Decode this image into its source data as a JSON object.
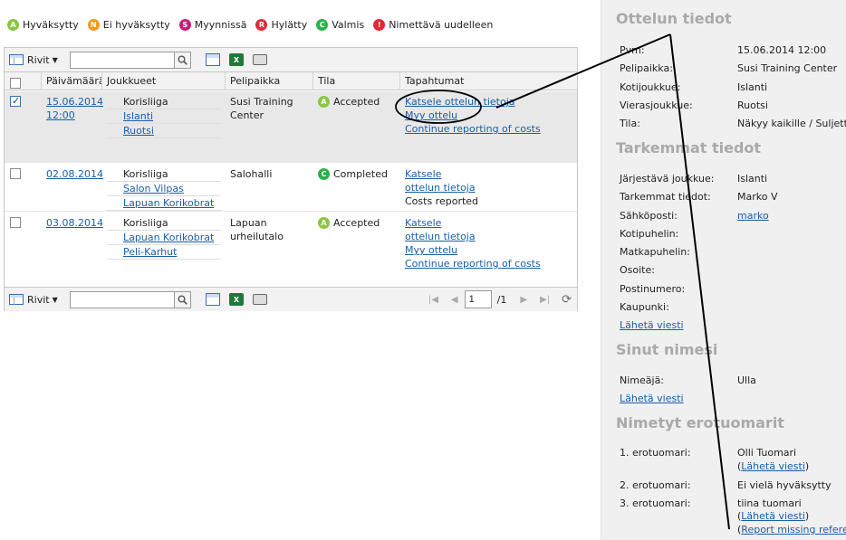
{
  "legend": [
    {
      "letter": "A",
      "label": "Hyväksytty",
      "color": "#8cc63f"
    },
    {
      "letter": "N",
      "label": "Ei hyväksytty",
      "color": "#f29a1f"
    },
    {
      "letter": "S",
      "label": "Myynnissä",
      "color": "#c4207a"
    },
    {
      "letter": "R",
      "label": "Hylätty",
      "color": "#e0293a"
    },
    {
      "letter": "C",
      "label": "Valmis",
      "color": "#2ab24a"
    },
    {
      "letter": "!",
      "label": "Nimettävä uudelleen",
      "color": "#e0293a"
    }
  ],
  "toolbar": {
    "rows_label": "Rivit",
    "search_value": "",
    "search_icon": "magnifier-icon",
    "page_value": "1",
    "page_of": "/1"
  },
  "columns": [
    "Päivämäärä",
    "Joukkueet",
    "Pelipaikka",
    "Tila",
    "Tapahtumat"
  ],
  "rows": [
    {
      "checked": true,
      "date": "15.06.2014",
      "time": "12:00",
      "league": "Korisliiga",
      "teams": [
        "Islanti",
        "Ruotsi"
      ],
      "place": "Susi Training Center",
      "state_letter": "A",
      "state_color": "#8cc63f",
      "state": "Accepted",
      "events_links": [
        "Katsele ottelun tietoja",
        "Myy ottelu",
        "Continue reporting of costs"
      ],
      "events_text": []
    },
    {
      "checked": false,
      "date": "02.08.2014",
      "time": "",
      "league": "Korisliiga",
      "teams": [
        "Salon Vilpas",
        "Lapuan Korikobrat"
      ],
      "place": "Salohalli",
      "state_letter": "C",
      "state_color": "#2ab24a",
      "state": "Completed",
      "events_links": [
        "Katsele ottelun tietoja"
      ],
      "events_text": [
        "Costs reported"
      ]
    },
    {
      "checked": false,
      "date": "03.08.2014",
      "time": "",
      "league": "Korisliiga",
      "teams": [
        "Lapuan Korikobrat",
        "Peli-Karhut"
      ],
      "place": "Lapuan urheilutalo",
      "state_letter": "A",
      "state_color": "#8cc63f",
      "state": "Accepted",
      "events_links": [
        "Katsele ottelun tietoja",
        "Myy ottelu",
        "Continue reporting of costs"
      ],
      "events_text": []
    }
  ],
  "side": {
    "match_title": "Ottelun tiedot",
    "match": [
      {
        "k": "Pvm:",
        "v": "15.06.2014 12:00"
      },
      {
        "k": "Pelipaikka:",
        "v": "Susi Training Center"
      },
      {
        "k": "Kotijoukkue:",
        "v": "Islanti"
      },
      {
        "k": "Vierasjoukkue:",
        "v": "Ruotsi"
      },
      {
        "k": "Tila:",
        "v": "Näkyy kaikille / Suljettu"
      }
    ],
    "details_title": "Tarkemmat tiedot",
    "details": [
      {
        "k": "Järjestävä joukkue:",
        "v": "Islanti",
        "link": false
      },
      {
        "k": "Tarkemmat tiedot:",
        "v": "Marko V",
        "link": false
      },
      {
        "k": "Sähköposti:",
        "v": "marko",
        "link": true
      },
      {
        "k": "Kotipuhelin:",
        "v": "",
        "link": false
      },
      {
        "k": "Matkapuhelin:",
        "v": "",
        "link": false
      },
      {
        "k": "Osoite:",
        "v": "",
        "link": false
      },
      {
        "k": "Postinumero:",
        "v": "",
        "link": false
      },
      {
        "k": "Kaupunki:",
        "v": "",
        "link": false
      }
    ],
    "send_message": "Lähetä viesti",
    "your_nomination_title": "Sinut nimesi",
    "nominator_label": "Nimeäjä:",
    "nominator_value": "Ulla",
    "referees_title": "Nimetyt erotuomarit",
    "ref1_label": "1. erotuomari:",
    "ref1_value": "Olli Tuomari",
    "ref2_label": "2. erotuomari:",
    "ref2_value": "Ei vielä hyväksytty",
    "ref3_label": "3. erotuomari:",
    "ref3_value": "tiina tuomari",
    "report_missing": "Report missing referee"
  }
}
